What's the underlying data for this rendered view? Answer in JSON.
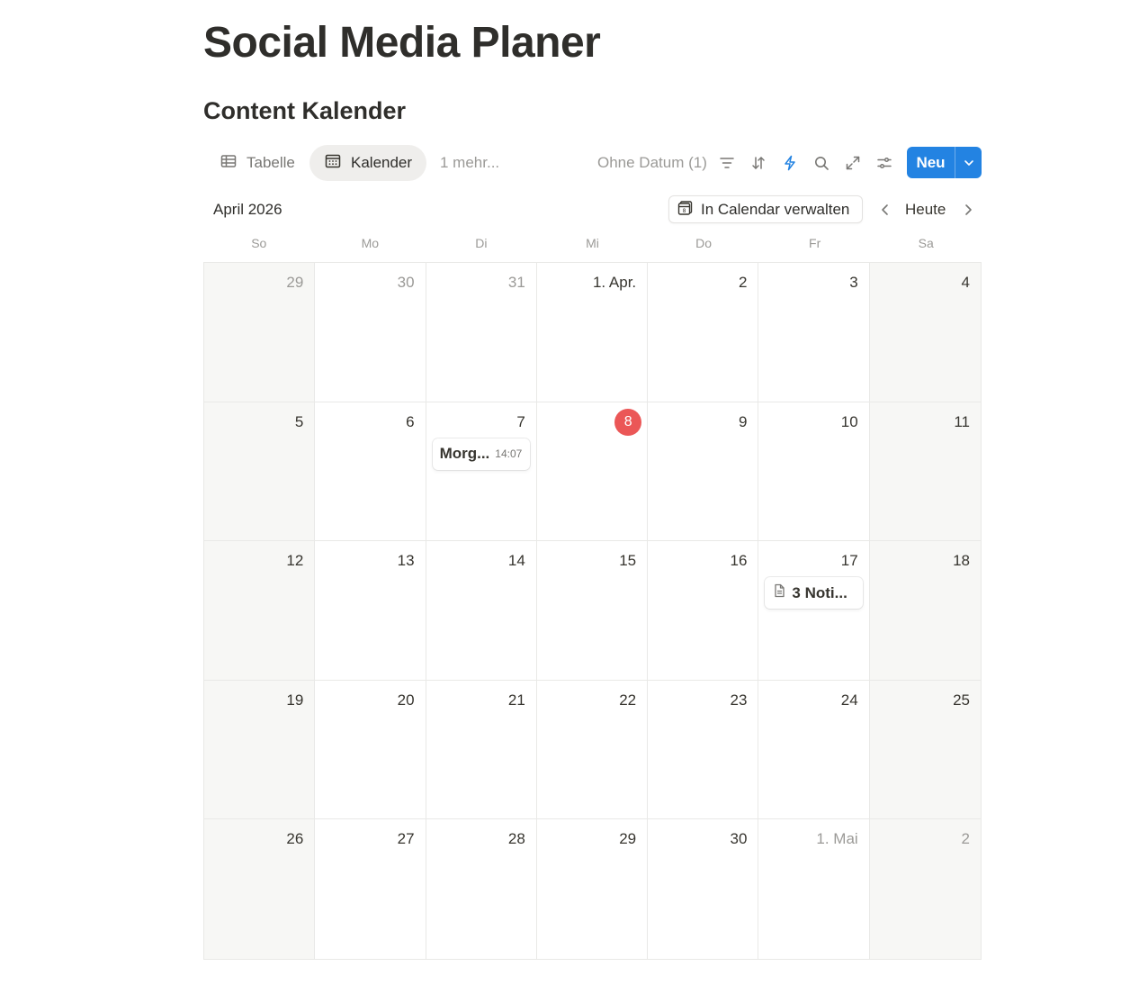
{
  "page": {
    "title": "Social Media Planer"
  },
  "database": {
    "title": "Content Kalender"
  },
  "views": {
    "tabs": [
      {
        "label": "Tabelle",
        "icon": "table-icon",
        "active": false
      },
      {
        "label": "Kalender",
        "icon": "calendar-icon",
        "active": true
      }
    ],
    "more_label": "1 mehr..."
  },
  "toolbar": {
    "no_date_label": "Ohne Datum (1)",
    "icons": [
      "filter-icon",
      "sort-icon",
      "automation-bolt-icon",
      "search-icon",
      "expand-icon",
      "settings-sliders-icon"
    ],
    "new_label": "Neu"
  },
  "calendar": {
    "month_label": "April 2026",
    "gcal_button_label": "In Calendar verwalten",
    "today_label": "Heute",
    "weekdays": [
      "So",
      "Mo",
      "Di",
      "Mi",
      "Do",
      "Fr",
      "Sa"
    ],
    "today_day": "8",
    "weeks": [
      [
        "29",
        "30",
        "31",
        "1. Apr.",
        "2",
        "3",
        "4"
      ],
      [
        "5",
        "6",
        "7",
        "8",
        "9",
        "10",
        "11"
      ],
      [
        "12",
        "13",
        "14",
        "15",
        "16",
        "17",
        "18"
      ],
      [
        "19",
        "20",
        "21",
        "22",
        "23",
        "24",
        "25"
      ],
      [
        "26",
        "27",
        "28",
        "29",
        "30",
        "1. Mai",
        "2"
      ]
    ],
    "muted_cells": [
      "0-0",
      "0-1",
      "0-2",
      "4-5",
      "4-6"
    ],
    "events": [
      {
        "title": "Morg...",
        "time": "14:07",
        "week": 1,
        "day": 2
      },
      {
        "title": "3 Noti...",
        "icon": "page-icon",
        "week": 2,
        "day": 5
      }
    ]
  },
  "colors": {
    "accent": "#2383e2",
    "today": "#eb5757",
    "weekend_bg": "#f7f7f5",
    "bolt": "#2383e2"
  }
}
